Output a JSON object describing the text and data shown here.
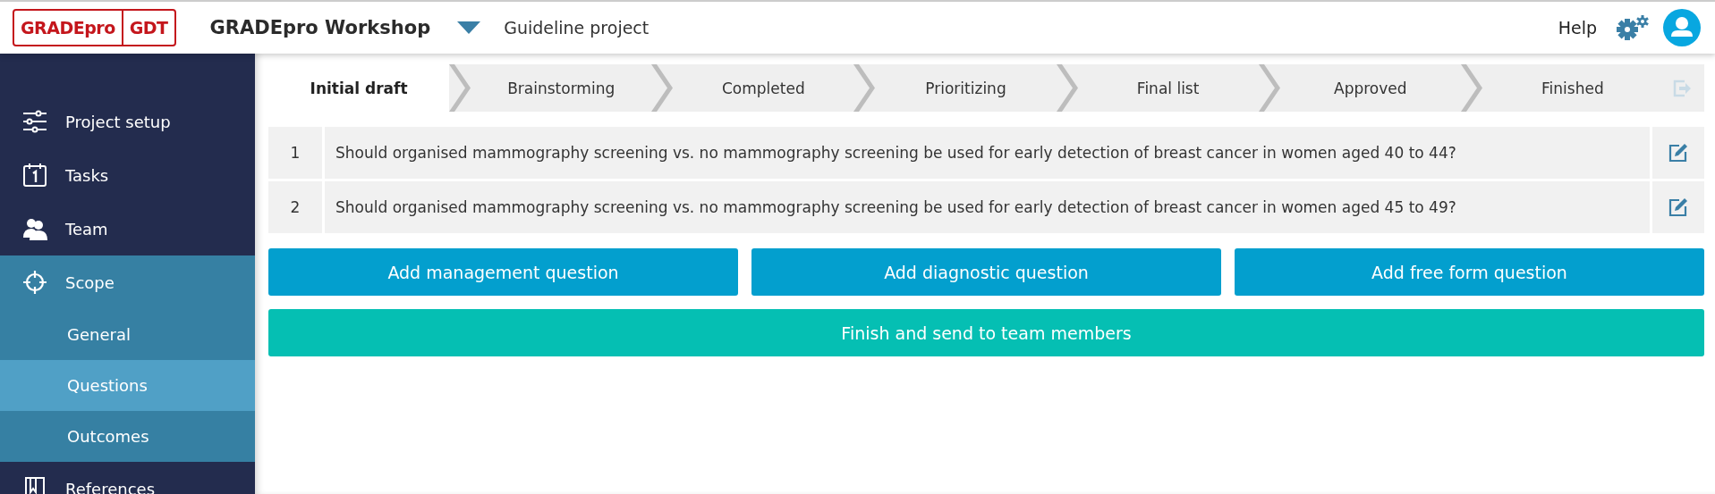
{
  "header": {
    "logo": [
      "GRADEpro",
      "GDT"
    ],
    "organization": "GRADEpro Workshop",
    "project": "Guideline project",
    "help": "Help"
  },
  "sidebar": {
    "items": [
      {
        "label": "Project setup",
        "selected": false
      },
      {
        "label": "Tasks",
        "selected": false
      },
      {
        "label": "Team",
        "selected": false
      },
      {
        "label": "Scope",
        "selected": false,
        "children": [
          {
            "label": "General",
            "selected": false
          },
          {
            "label": "Questions",
            "selected": true
          },
          {
            "label": "Outcomes",
            "selected": false
          }
        ]
      },
      {
        "label": "References",
        "selected": false
      }
    ]
  },
  "steps": [
    {
      "label": "Initial draft",
      "selected": true
    },
    {
      "label": "Brainstorming",
      "selected": false
    },
    {
      "label": "Completed",
      "selected": false
    },
    {
      "label": "Prioritizing",
      "selected": false
    },
    {
      "label": "Final list",
      "selected": false
    },
    {
      "label": "Approved",
      "selected": false
    },
    {
      "label": "Finished",
      "selected": false
    }
  ],
  "questions": [
    {
      "number": "1",
      "text": "Should organised mammography screening vs. no mammography screening be used for early detection of breast cancer in women aged 40 to 44?"
    },
    {
      "number": "2",
      "text": "Should organised mammography screening vs. no mammography screening be used for early detection of breast cancer in women aged 45 to 49?"
    }
  ],
  "buttons": [
    {
      "label": "Add management question",
      "kind": "add"
    },
    {
      "label": "Add diagnostic question",
      "kind": "add"
    },
    {
      "label": "Add free form question",
      "kind": "add"
    },
    {
      "label": "Finish and send to team members",
      "kind": "finish"
    }
  ]
}
